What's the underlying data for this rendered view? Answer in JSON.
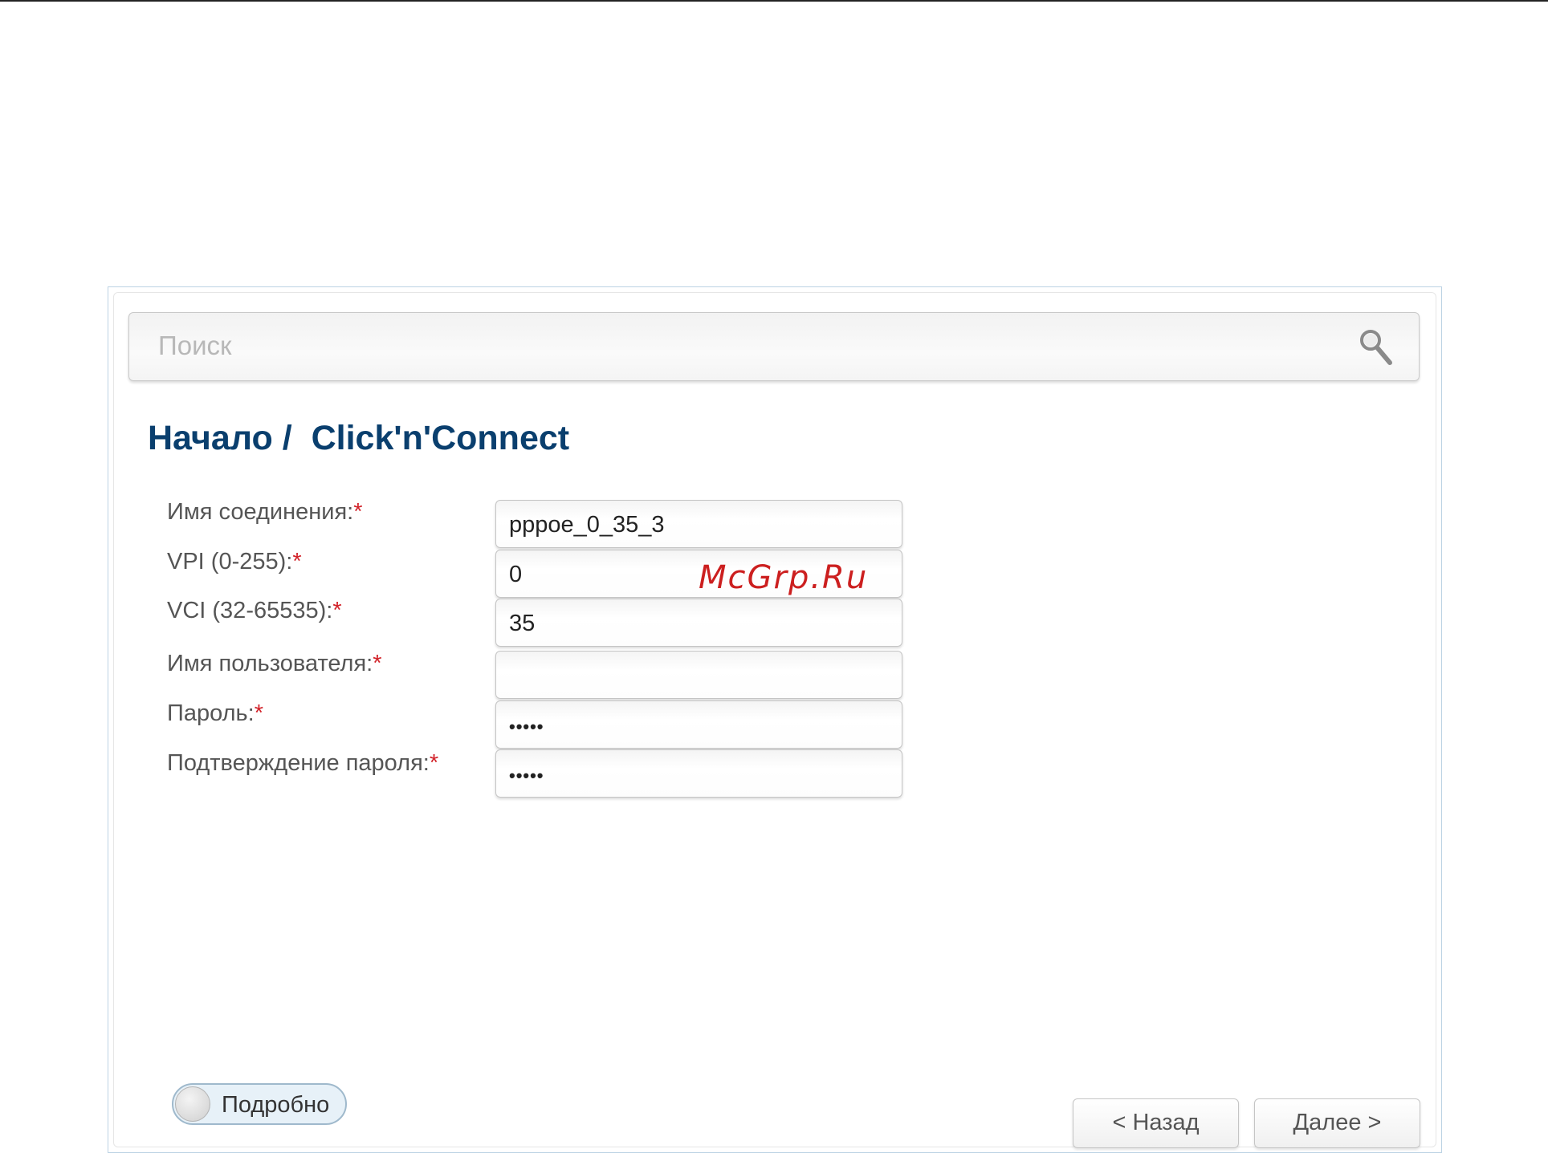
{
  "search": {
    "placeholder": "Поиск"
  },
  "breadcrumb": {
    "home": "Начало",
    "separator": " / ",
    "current": "Click'n'Connect"
  },
  "form": {
    "required_mark": "*",
    "fields": [
      {
        "label": "Имя соединения:",
        "value": "pppoe_0_35_3"
      },
      {
        "label": "VPI (0-255):",
        "value": "0"
      },
      {
        "label": "VCI (32-65535):",
        "value": "35"
      },
      {
        "label": "Имя пользователя:",
        "value": ""
      },
      {
        "label": "Пароль:",
        "value": "•••••"
      },
      {
        "label": "Подтверждение пароля:",
        "value": "•••••"
      }
    ]
  },
  "watermark": "McGrp.Ru",
  "toggle": {
    "label": "Подробно",
    "state": "off"
  },
  "buttons": {
    "back": "< Назад",
    "next": "Далее >"
  },
  "colors": {
    "title": "#0a3f6e",
    "required": "#d2232a",
    "watermark": "#cc1f1f"
  },
  "icons": {
    "search": "magnifier-icon"
  }
}
